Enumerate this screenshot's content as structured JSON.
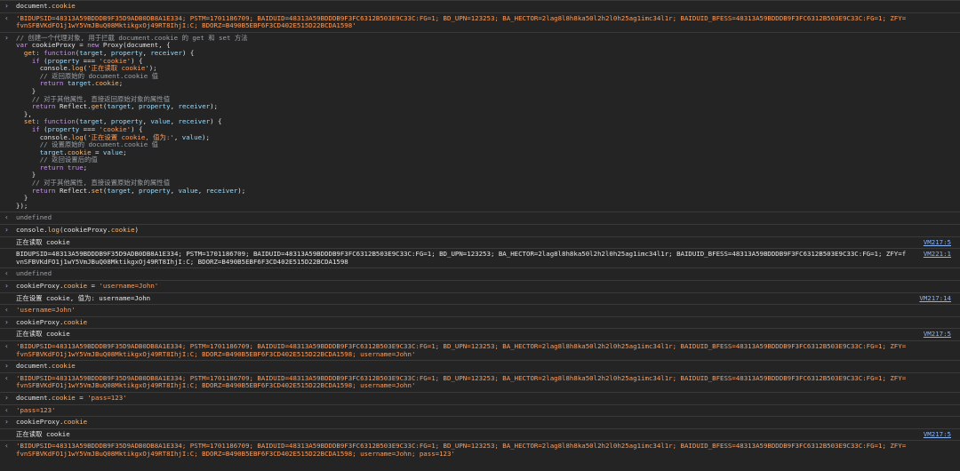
{
  "colors": {
    "background": "#242424",
    "string": "#ff9d5c",
    "link": "#8ab4f8",
    "keyword": "#c792ea",
    "comment": "#9aa0a6"
  },
  "icons": {
    "input": "chevron-right-icon",
    "output": "chevron-left-icon"
  },
  "entries": [
    {
      "kind": "input",
      "text": "document.cookie"
    },
    {
      "kind": "output",
      "text": "'BIDUPSID=48313A59BDDDB9F35D9ADB0DB8A1E334; PSTM=1701186709; BAIDUID=48313A59BDDDB9F3FC6312B503E9C33C:FG=1; BD_UPN=123253; BA_HECTOR=2lag8l8h8ka50l2h2l0h25ag1imc34l1r; BAIDUID_BFESS=48313A59BDDDB9F3FC6312B503E9C33C:FG=1; ZFY=fvnSFBVKdFO1j1wY5VmJBuQ08MktikgxOj49RT8IhjI:C; BDORZ=B490B5EBF6F3CD402E515D22BCDA1598'"
    },
    {
      "kind": "code",
      "lines": [
        "// 创建一个代理对象, 用于拦截 document.cookie 的 get 和 set 方法",
        "var cookieProxy = new Proxy(document, {",
        "  get: function(target, property, receiver) {",
        "    if (property === 'cookie') {",
        "      console.log('正在读取 cookie');",
        "      // 返回原始的 document.cookie 值",
        "      return target.cookie;",
        "    }",
        "    // 对于其他属性, 直接返回原始对象的属性值",
        "    return Reflect.get(target, property, receiver);",
        "  },",
        "  set: function(target, property, value, receiver) {",
        "    if (property === 'cookie') {",
        "      console.log('正在设置 cookie, 值为:', value);",
        "      // 设置原始的 document.cookie 值",
        "      target.cookie = value;",
        "      // 返回设置后的值",
        "      return true;",
        "    }",
        "    // 对于其他属性, 直接设置原始对象的属性值",
        "    return Reflect.set(target, property, value, receiver);",
        "  }",
        "});"
      ]
    },
    {
      "kind": "undef",
      "text": "undefined"
    },
    {
      "kind": "input",
      "text": "console.log(cookieProxy.cookie)"
    },
    {
      "kind": "log",
      "text": "正在读取 cookie",
      "src": "VM217:5"
    },
    {
      "kind": "log",
      "text": "BIDUPSID=48313A59BDDDB9F35D9ADB0DB8A1E334; PSTM=1701186709; BAIDUID=48313A59BDDDB9F3FC6312B503E9C33C:FG=1; BD_UPN=123253; BA_HECTOR=2lag8l8h8ka50l2h2l0h25ag1imc34l1r; BAIDUID_BFESS=48313A59BDDDB9F3FC6312B503E9C33C:FG=1; ZFY=fvnSFBVKdFO1j1wY5VmJBuQ08MktikgxOj49RT8IhjI:C; BDORZ=B490B5EBF6F3CD402E515D22BCDA1598",
      "src": "VM221:1"
    },
    {
      "kind": "undef",
      "text": "undefined"
    },
    {
      "kind": "input",
      "text": "cookieProxy.cookie = 'username=John'"
    },
    {
      "kind": "log",
      "text": "正在设置 cookie, 值为: username=John",
      "src": "VM217:14"
    },
    {
      "kind": "output",
      "text": "'username=John'"
    },
    {
      "kind": "input",
      "text": "cookieProxy.cookie"
    },
    {
      "kind": "log",
      "text": "正在读取 cookie",
      "src": "VM217:5"
    },
    {
      "kind": "output",
      "text": "'BIDUPSID=48313A59BDDDB9F35D9ADB0DB8A1E334; PSTM=1701186709; BAIDUID=48313A59BDDDB9F3FC6312B503E9C33C:FG=1; BD_UPN=123253; BA_HECTOR=2lag8l8h8ka50l2h2l0h25ag1imc34l1r; BAIDUID_BFESS=48313A59BDDDB9F3FC6312B503E9C33C:FG=1; ZFY=fvnSFBVKdFO1j1wY5VmJBuQ08MktikgxOj49RT8IhjI:C; BDORZ=B490B5EBF6F3CD402E515D22BCDA1598; username=John'"
    },
    {
      "kind": "input",
      "text": "document.cookie"
    },
    {
      "kind": "output",
      "text": "'BIDUPSID=48313A59BDDDB9F35D9ADB0DB8A1E334; PSTM=1701186709; BAIDUID=48313A59BDDDB9F3FC6312B503E9C33C:FG=1; BD_UPN=123253; BA_HECTOR=2lag8l8h8ka50l2h2l0h25ag1imc34l1r; BAIDUID_BFESS=48313A59BDDDB9F3FC6312B503E9C33C:FG=1; ZFY=fvnSFBVKdFO1j1wY5VmJBuQ08MktikgxOj49RT8IhjI:C; BDORZ=B490B5EBF6F3CD402E515D22BCDA1598; username=John'"
    },
    {
      "kind": "input",
      "text": "document.cookie = 'pass=123'"
    },
    {
      "kind": "output",
      "text": "'pass=123'"
    },
    {
      "kind": "input",
      "text": "cookieProxy.cookie"
    },
    {
      "kind": "log",
      "text": "正在读取 cookie",
      "src": "VM217:5"
    },
    {
      "kind": "output",
      "text": "'BIDUPSID=48313A59BDDDB9F35D9ADB0DB8A1E334; PSTM=1701186709; BAIDUID=48313A59BDDDB9F3FC6312B503E9C33C:FG=1; BD_UPN=123253; BA_HECTOR=2lag8l8h8ka50l2h2l0h25ag1imc34l1r; BAIDUID_BFESS=48313A59BDDDB9F3FC6312B503E9C33C:FG=1; ZFY=fvnSFBVKdFO1j1wY5VmJBuQ08MktikgxOj49RT8IhjI:C; BDORZ=B490B5EBF6F3CD402E515D22BCDA1598; username=John; pass=123'"
    }
  ]
}
